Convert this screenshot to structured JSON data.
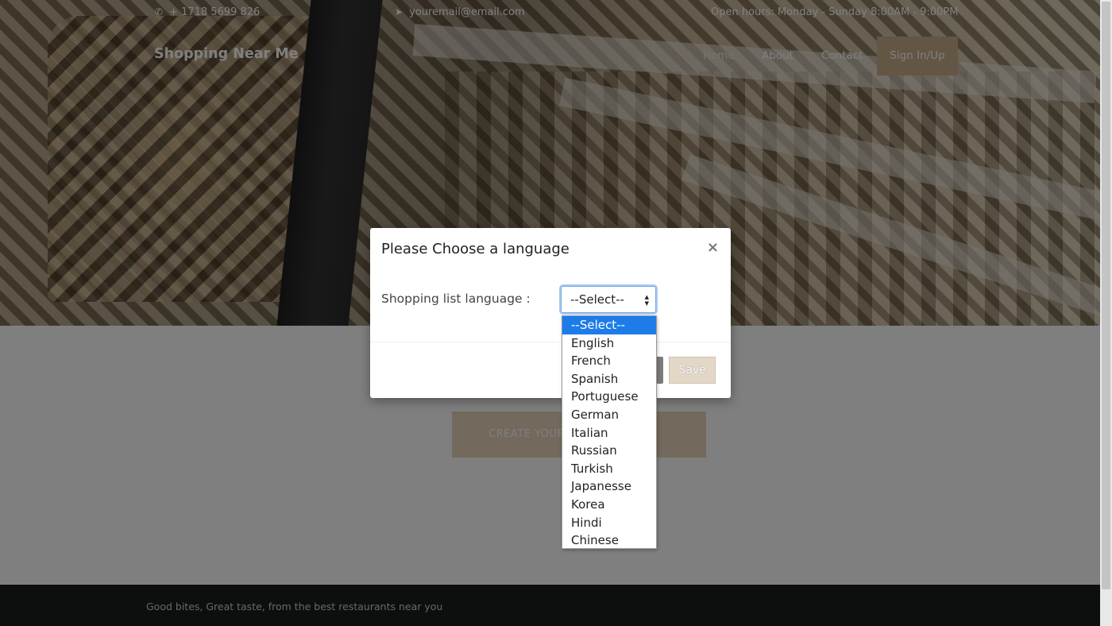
{
  "topbar": {
    "phone": "+ 1718 5699 826",
    "email": "youremail@email.com",
    "hours": "Open hours: Monday - Sunday 8:00AM - 9:00PM"
  },
  "nav": {
    "brand": "Shopping Near Me",
    "home": "Home",
    "about": "About",
    "contact": "Contact",
    "signin": "Sign In/Up"
  },
  "main": {
    "cta_label": "CREATE YOUR"
  },
  "footer": {
    "text": "Good bites, Great taste, from the best restaurants near you"
  },
  "modal": {
    "title": "Please Choose a language",
    "close_symbol": "×",
    "field_label": "Shopping list language :",
    "select_value": "--Select--",
    "save_label": "Save",
    "options": [
      "--Select--",
      "English",
      "French",
      "Spanish",
      "Portuguese",
      "German",
      "Italian",
      "Russian",
      "Turkish",
      "Japanesse",
      "Korea",
      "Hindi",
      "Chinese"
    ]
  },
  "colors": {
    "accent": "#c8ad88",
    "selected_option": "#1e7ce8",
    "footer_bg": "#1b1e1c"
  }
}
